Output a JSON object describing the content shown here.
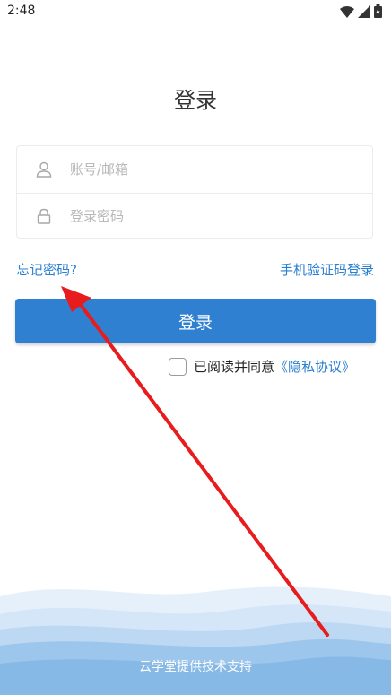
{
  "status_bar": {
    "time": "2:48"
  },
  "page": {
    "title": "登录"
  },
  "form": {
    "account_placeholder": "账号/邮箱",
    "password_placeholder": "登录密码"
  },
  "links": {
    "forgot_password": "忘记密码?",
    "sms_login": "手机验证码登录"
  },
  "login_button": {
    "label": "登录"
  },
  "agreement": {
    "text": "已阅读并同意",
    "privacy_link": "《隐私协议》",
    "checked": false
  },
  "footer": {
    "text": "云学堂提供技术支持"
  },
  "colors": {
    "accent": "#2f80d0",
    "link": "#2a7fd0",
    "annotation": "#e81c1c"
  },
  "icons": {
    "wifi": "wifi-icon",
    "signal": "signal-icon",
    "battery": "battery-icon",
    "user": "user-icon",
    "lock": "lock-icon"
  }
}
